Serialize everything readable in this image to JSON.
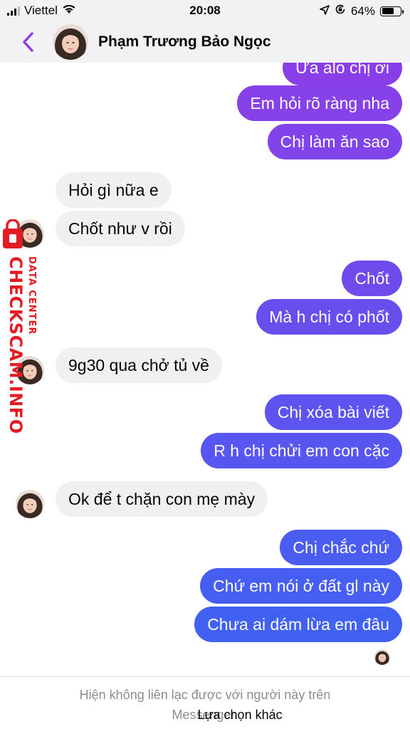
{
  "status_bar": {
    "carrier": "Viettel",
    "time": "20:08",
    "battery": "64%",
    "battery_level": 0.64,
    "icons": [
      "signal-icon",
      "wifi-icon",
      "location-icon",
      "orientation-lock-icon",
      "battery-icon"
    ]
  },
  "header": {
    "contact_name": "Phạm Trương Bảo Ngọc",
    "back_icon": "chevron-left-icon"
  },
  "colors": {
    "accent": "#8e3ee8",
    "bubble_top": "#8b3ee8",
    "bubble_bottom": "#3a64f4",
    "incoming_bubble": "#f0f0f0",
    "watermark": "#e31b23"
  },
  "messages": [
    {
      "direction": "out",
      "text": "Ừa alo chị ơi"
    },
    {
      "direction": "out",
      "text": "Em hỏi rõ ràng nha"
    },
    {
      "direction": "out",
      "text": "Chị làm ăn sao"
    },
    {
      "direction": "in",
      "text": "Hỏi gì nữa e"
    },
    {
      "direction": "in",
      "text": "Chốt như v rồi"
    },
    {
      "direction": "out",
      "text": "Chốt"
    },
    {
      "direction": "out",
      "text": "Mà h chị có phốt"
    },
    {
      "direction": "in",
      "text": "9g30 qua chở tủ về"
    },
    {
      "direction": "out",
      "text": "Chị xóa bài viết"
    },
    {
      "direction": "out",
      "text": "R h chị chửi em con cặc"
    },
    {
      "direction": "in",
      "text": "Ok để t chặn con mẹ mày"
    },
    {
      "direction": "out",
      "text": "Chị chắc chứ"
    },
    {
      "direction": "out",
      "text": "Chứ em nói ở đất gl này"
    },
    {
      "direction": "out",
      "text": "Chưa ai dám lừa em đâu"
    }
  ],
  "watermark": {
    "main": "CHECKSCAM.INFO",
    "sub": "DATA CENTER"
  },
  "footer": {
    "notice": "Hiện không liên lạc được với người này trên Messenger.",
    "action": "Lựa chọn khác"
  }
}
